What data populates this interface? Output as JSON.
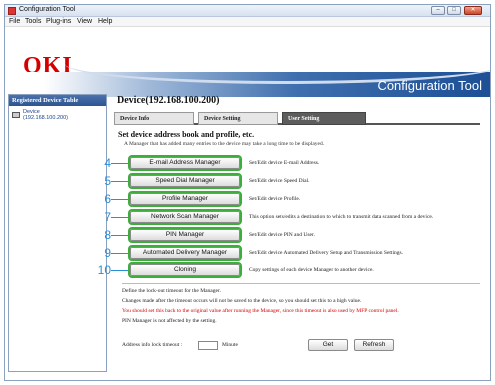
{
  "window": {
    "title": "Configuration Tool",
    "controls": [
      "–",
      "□",
      "✕"
    ]
  },
  "menu": [
    "File",
    "Tools",
    "Plug-ins",
    "View",
    "Help"
  ],
  "banner": {
    "logo": "OKI",
    "app_title": "Configuration Tool"
  },
  "sidebar": {
    "header": "Registered Device Table",
    "device_name": "Device",
    "device_ip": "(192.168.100.200)"
  },
  "device_title": "Device(192.168.100.200)",
  "tabs": [
    {
      "label": "Device Info",
      "active": false
    },
    {
      "label": "Device Setting",
      "active": false
    },
    {
      "label": "User Setting",
      "active": true
    }
  ],
  "panel": {
    "heading": "Set device address book and profile, etc.",
    "note": "A Manager that has added many entries to the device may take a long time to be displayed."
  },
  "managers": [
    {
      "num": "4",
      "label": "E-mail Address Manager",
      "desc": "Set/Edit device E-mail Address."
    },
    {
      "num": "5",
      "label": "Speed Dial Manager",
      "desc": "Set/Edit device Speed Dial."
    },
    {
      "num": "6",
      "label": "Profile Manager",
      "desc": "Set/Edit device Profile."
    },
    {
      "num": "7",
      "label": "Network Scan Manager",
      "desc": "This option sets/edits a destination to which to transmit data scanned from a device."
    },
    {
      "num": "8",
      "label": "PIN Manager",
      "desc": "Set/Edit device PIN and User."
    },
    {
      "num": "9",
      "label": "Automated Delivery Manager",
      "desc": "Set/Edit device Automated Delivery Setup and Transmission Settings."
    },
    {
      "num": "10",
      "label": "Cloning",
      "desc": "Copy settings of each device Manager to another device."
    }
  ],
  "lockout": {
    "line1": "Define the lock-out timeout for the Manager.",
    "line2": "Changes made after the timeout occurs will not be saved to the device, so you should set this to a high value.",
    "line3": "You should set this back to the original value after running the Manager, since this timeout is also used by MFP control panel.",
    "line4": "PIN Manager is not affected by the setting.",
    "input_label": "Address info lock timeout :",
    "input_value": "",
    "unit": "Minute",
    "get_label": "Get",
    "refresh_label": "Refresh"
  },
  "colors": {
    "accent_blue": "#1d4f96",
    "logo_red": "#d40000",
    "highlight_green": "#3cae3c",
    "callout_blue": "#2a8fd6"
  }
}
